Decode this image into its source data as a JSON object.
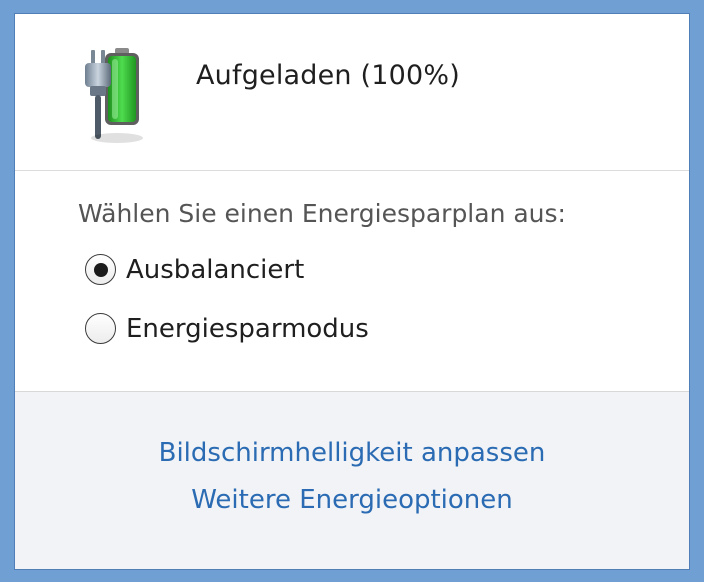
{
  "battery": {
    "icon": "battery-charging-plug-icon",
    "status": "Aufgeladen (100%)",
    "charge_fraction": 1.0,
    "fill_color": "#2fbf2f"
  },
  "power_plan": {
    "heading": "Wählen Sie einen Energiesparplan aus:",
    "options": [
      {
        "label": "Ausbalanciert",
        "selected": true
      },
      {
        "label": "Energiesparmodus",
        "selected": false
      }
    ]
  },
  "links": {
    "brightness": "Bildschirmhelligkeit anpassen",
    "more_options": "Weitere Energieoptionen"
  },
  "colors": {
    "frame": "#6f9fd3",
    "link": "#2a6bb3",
    "footer_bg": "#f1f3f6"
  }
}
